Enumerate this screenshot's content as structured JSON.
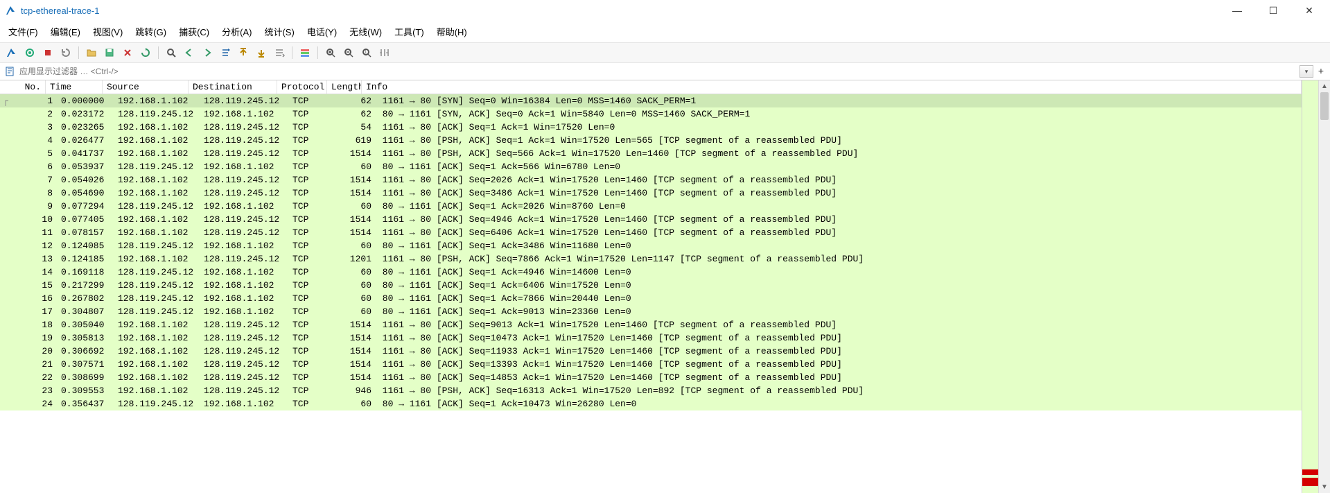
{
  "window": {
    "title": "tcp-ethereal-trace-1"
  },
  "menu": {
    "file": "文件(F)",
    "edit": "编辑(E)",
    "view": "视图(V)",
    "go": "跳转(G)",
    "capture": "捕获(C)",
    "analyze": "分析(A)",
    "stats": "统计(S)",
    "tele": "电话(Y)",
    "wireless": "无线(W)",
    "tools": "工具(T)",
    "help": "帮助(H)"
  },
  "filter": {
    "placeholder": "应用显示过滤器 … <Ctrl-/>"
  },
  "columns": {
    "no": "No.",
    "time": "Time",
    "src": "Source",
    "dst": "Destination",
    "proto": "Protocol",
    "len": "Length",
    "info": "Info"
  },
  "packets": [
    {
      "no": "1",
      "time": "0.000000",
      "src": "192.168.1.102",
      "dst": "128.119.245.12",
      "proto": "TCP",
      "len": "62",
      "info": "1161 → 80 [SYN] Seq=0 Win=16384 Len=0 MSS=1460 SACK_PERM=1",
      "selected": true
    },
    {
      "no": "2",
      "time": "0.023172",
      "src": "128.119.245.12",
      "dst": "192.168.1.102",
      "proto": "TCP",
      "len": "62",
      "info": "80 → 1161 [SYN, ACK] Seq=0 Ack=1 Win=5840 Len=0 MSS=1460 SACK_PERM=1"
    },
    {
      "no": "3",
      "time": "0.023265",
      "src": "192.168.1.102",
      "dst": "128.119.245.12",
      "proto": "TCP",
      "len": "54",
      "info": "1161 → 80 [ACK] Seq=1 Ack=1 Win=17520 Len=0"
    },
    {
      "no": "4",
      "time": "0.026477",
      "src": "192.168.1.102",
      "dst": "128.119.245.12",
      "proto": "TCP",
      "len": "619",
      "info": "1161 → 80 [PSH, ACK] Seq=1 Ack=1 Win=17520 Len=565 [TCP segment of a reassembled PDU]"
    },
    {
      "no": "5",
      "time": "0.041737",
      "src": "192.168.1.102",
      "dst": "128.119.245.12",
      "proto": "TCP",
      "len": "1514",
      "info": "1161 → 80 [PSH, ACK] Seq=566 Ack=1 Win=17520 Len=1460 [TCP segment of a reassembled PDU]"
    },
    {
      "no": "6",
      "time": "0.053937",
      "src": "128.119.245.12",
      "dst": "192.168.1.102",
      "proto": "TCP",
      "len": "60",
      "info": "80 → 1161 [ACK] Seq=1 Ack=566 Win=6780 Len=0"
    },
    {
      "no": "7",
      "time": "0.054026",
      "src": "192.168.1.102",
      "dst": "128.119.245.12",
      "proto": "TCP",
      "len": "1514",
      "info": "1161 → 80 [ACK] Seq=2026 Ack=1 Win=17520 Len=1460 [TCP segment of a reassembled PDU]"
    },
    {
      "no": "8",
      "time": "0.054690",
      "src": "192.168.1.102",
      "dst": "128.119.245.12",
      "proto": "TCP",
      "len": "1514",
      "info": "1161 → 80 [ACK] Seq=3486 Ack=1 Win=17520 Len=1460 [TCP segment of a reassembled PDU]"
    },
    {
      "no": "9",
      "time": "0.077294",
      "src": "128.119.245.12",
      "dst": "192.168.1.102",
      "proto": "TCP",
      "len": "60",
      "info": "80 → 1161 [ACK] Seq=1 Ack=2026 Win=8760 Len=0"
    },
    {
      "no": "10",
      "time": "0.077405",
      "src": "192.168.1.102",
      "dst": "128.119.245.12",
      "proto": "TCP",
      "len": "1514",
      "info": "1161 → 80 [ACK] Seq=4946 Ack=1 Win=17520 Len=1460 [TCP segment of a reassembled PDU]"
    },
    {
      "no": "11",
      "time": "0.078157",
      "src": "192.168.1.102",
      "dst": "128.119.245.12",
      "proto": "TCP",
      "len": "1514",
      "info": "1161 → 80 [ACK] Seq=6406 Ack=1 Win=17520 Len=1460 [TCP segment of a reassembled PDU]"
    },
    {
      "no": "12",
      "time": "0.124085",
      "src": "128.119.245.12",
      "dst": "192.168.1.102",
      "proto": "TCP",
      "len": "60",
      "info": "80 → 1161 [ACK] Seq=1 Ack=3486 Win=11680 Len=0"
    },
    {
      "no": "13",
      "time": "0.124185",
      "src": "192.168.1.102",
      "dst": "128.119.245.12",
      "proto": "TCP",
      "len": "1201",
      "info": "1161 → 80 [PSH, ACK] Seq=7866 Ack=1 Win=17520 Len=1147 [TCP segment of a reassembled PDU]"
    },
    {
      "no": "14",
      "time": "0.169118",
      "src": "128.119.245.12",
      "dst": "192.168.1.102",
      "proto": "TCP",
      "len": "60",
      "info": "80 → 1161 [ACK] Seq=1 Ack=4946 Win=14600 Len=0"
    },
    {
      "no": "15",
      "time": "0.217299",
      "src": "128.119.245.12",
      "dst": "192.168.1.102",
      "proto": "TCP",
      "len": "60",
      "info": "80 → 1161 [ACK] Seq=1 Ack=6406 Win=17520 Len=0"
    },
    {
      "no": "16",
      "time": "0.267802",
      "src": "128.119.245.12",
      "dst": "192.168.1.102",
      "proto": "TCP",
      "len": "60",
      "info": "80 → 1161 [ACK] Seq=1 Ack=7866 Win=20440 Len=0"
    },
    {
      "no": "17",
      "time": "0.304807",
      "src": "128.119.245.12",
      "dst": "192.168.1.102",
      "proto": "TCP",
      "len": "60",
      "info": "80 → 1161 [ACK] Seq=1 Ack=9013 Win=23360 Len=0"
    },
    {
      "no": "18",
      "time": "0.305040",
      "src": "192.168.1.102",
      "dst": "128.119.245.12",
      "proto": "TCP",
      "len": "1514",
      "info": "1161 → 80 [ACK] Seq=9013 Ack=1 Win=17520 Len=1460 [TCP segment of a reassembled PDU]"
    },
    {
      "no": "19",
      "time": "0.305813",
      "src": "192.168.1.102",
      "dst": "128.119.245.12",
      "proto": "TCP",
      "len": "1514",
      "info": "1161 → 80 [ACK] Seq=10473 Ack=1 Win=17520 Len=1460 [TCP segment of a reassembled PDU]"
    },
    {
      "no": "20",
      "time": "0.306692",
      "src": "192.168.1.102",
      "dst": "128.119.245.12",
      "proto": "TCP",
      "len": "1514",
      "info": "1161 → 80 [ACK] Seq=11933 Ack=1 Win=17520 Len=1460 [TCP segment of a reassembled PDU]"
    },
    {
      "no": "21",
      "time": "0.307571",
      "src": "192.168.1.102",
      "dst": "128.119.245.12",
      "proto": "TCP",
      "len": "1514",
      "info": "1161 → 80 [ACK] Seq=13393 Ack=1 Win=17520 Len=1460 [TCP segment of a reassembled PDU]"
    },
    {
      "no": "22",
      "time": "0.308699",
      "src": "192.168.1.102",
      "dst": "128.119.245.12",
      "proto": "TCP",
      "len": "1514",
      "info": "1161 → 80 [ACK] Seq=14853 Ack=1 Win=17520 Len=1460 [TCP segment of a reassembled PDU]"
    },
    {
      "no": "23",
      "time": "0.309553",
      "src": "192.168.1.102",
      "dst": "128.119.245.12",
      "proto": "TCP",
      "len": "946",
      "info": "1161 → 80 [PSH, ACK] Seq=16313 Ack=1 Win=17520 Len=892 [TCP segment of a reassembled PDU]"
    },
    {
      "no": "24",
      "time": "0.356437",
      "src": "128.119.245.12",
      "dst": "192.168.1.102",
      "proto": "TCP",
      "len": "60",
      "info": "80 → 1161 [ACK] Seq=1 Ack=10473 Win=26280 Len=0"
    }
  ],
  "toolbar_icons": [
    "app-fin-icon",
    "open-file-icon",
    "save-icon",
    "close-icon",
    "reload-icon",
    "find-icon",
    "go-back-icon",
    "go-forward-icon",
    "jump-icon",
    "go-first-icon",
    "go-last-icon",
    "autoscroll-icon",
    "colorize-icon",
    "zoom-in-icon",
    "zoom-out-icon",
    "zoom-reset-icon",
    "resize-cols-icon"
  ]
}
